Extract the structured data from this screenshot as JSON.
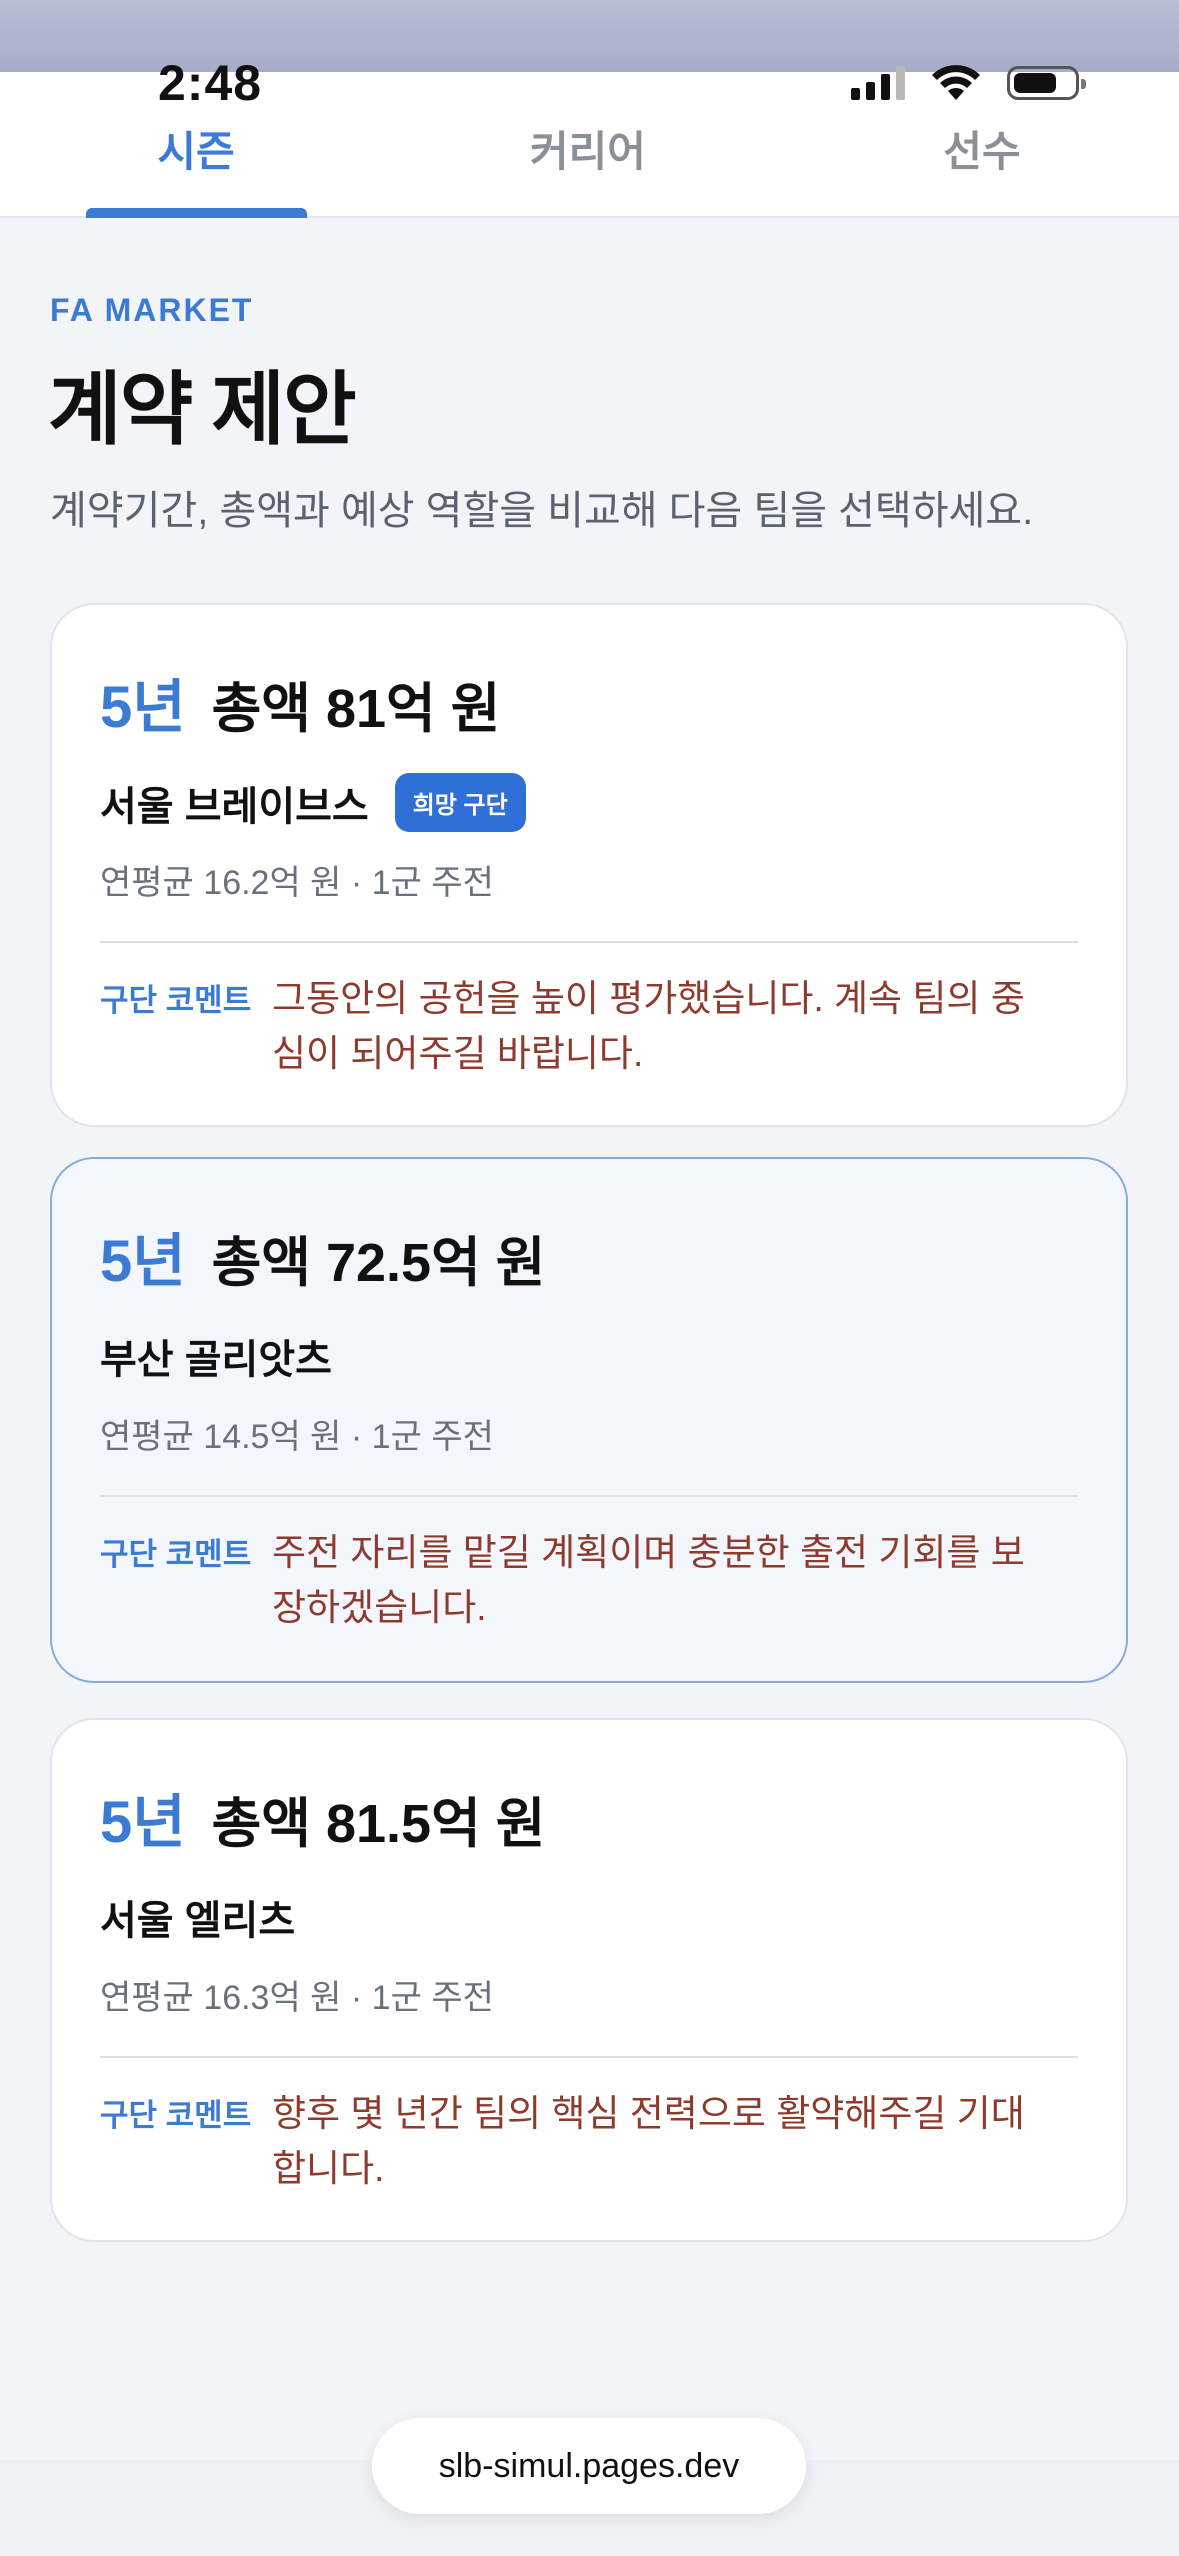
{
  "status": {
    "time": "2:48"
  },
  "tabs": [
    {
      "label": "시즌",
      "active": true
    },
    {
      "label": "커리어",
      "active": false
    },
    {
      "label": "선수",
      "active": false
    }
  ],
  "header": {
    "eyebrow": "FA MARKET",
    "title": "계약 제안",
    "subtitle": "계약기간, 총액과 예상 역할을 비교해 다음 팀을 선택하세요."
  },
  "offers": [
    {
      "years": "5년",
      "total": "총액 81억 원",
      "team": "서울 브레이브스",
      "badge": "희망 구단",
      "meta": "연평균 16.2억 원 · 1군 주전",
      "comment_label": "구단 코멘트",
      "comment": "그동안의 공헌을 높이 평가했습니다. 계속 팀의 중심이 되어주길 바랍니다."
    },
    {
      "years": "5년",
      "total": "총액 72.5억 원",
      "team": "부산 골리앗츠",
      "meta": "연평균 14.5억 원 · 1군 주전",
      "comment_label": "구단 코멘트",
      "comment": "주전 자리를 맡길 계획이며 충분한 출전 기회를 보장하겠습니다."
    },
    {
      "years": "5년",
      "total": "총액 81.5억 원",
      "team": "서울 엘리츠",
      "meta": "연평균 16.3억 원 · 1군 주전",
      "comment_label": "구단 코멘트",
      "comment": "향후 몇 년간 팀의 핵심 전력으로 활약해주길 기대합니다."
    }
  ],
  "browser": {
    "url": "slb-simul.pages.dev"
  },
  "colors": {
    "accent": "#3b7bd4",
    "comment": "#8e3a2c",
    "background": "#f2f4f8"
  }
}
